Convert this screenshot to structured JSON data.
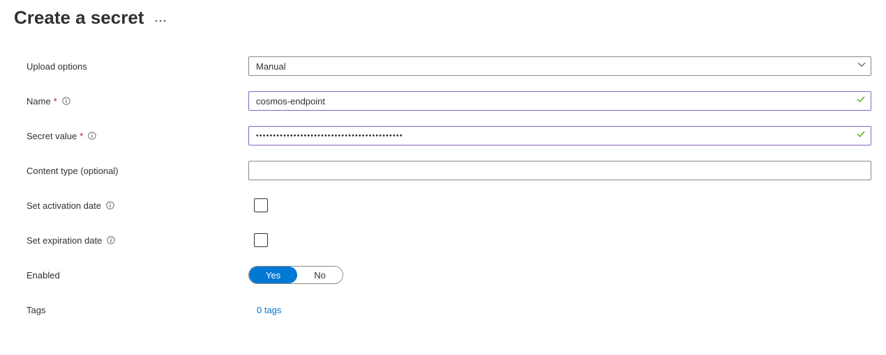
{
  "header": {
    "title": "Create a secret"
  },
  "form": {
    "upload_options": {
      "label": "Upload options",
      "value": "Manual"
    },
    "name": {
      "label": "Name",
      "value": "cosmos-endpoint"
    },
    "secret_value": {
      "label": "Secret value",
      "value": "•••••••••••••••••••••••••••••••••••••••••••"
    },
    "content_type": {
      "label": "Content type (optional)",
      "value": ""
    },
    "activation_date": {
      "label": "Set activation date"
    },
    "expiration_date": {
      "label": "Set expiration date"
    },
    "enabled": {
      "label": "Enabled",
      "yes": "Yes",
      "no": "No"
    },
    "tags": {
      "label": "Tags",
      "link": "0 tags"
    }
  }
}
